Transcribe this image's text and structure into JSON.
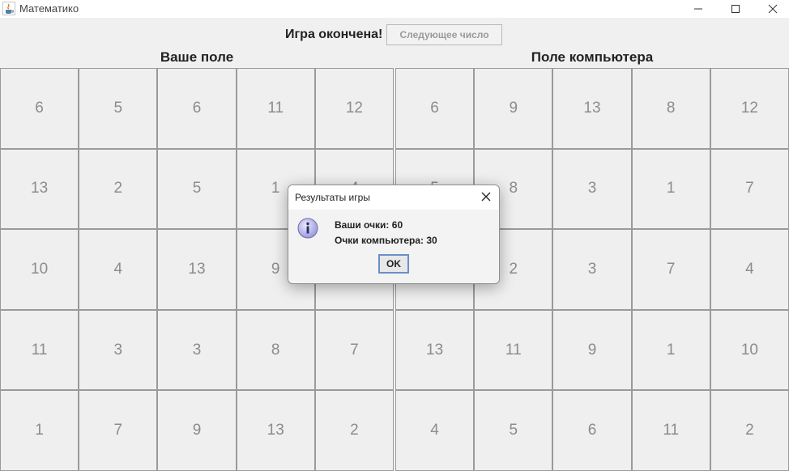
{
  "window": {
    "title": "Математико"
  },
  "status": {
    "game_over_text": "Игра окончена!",
    "next_number_label": "Следующее число"
  },
  "player_board": {
    "title": "Ваше поле",
    "cells": [
      "6",
      "5",
      "6",
      "11",
      "12",
      "13",
      "2",
      "5",
      "1",
      "4",
      "10",
      "4",
      "13",
      "9",
      "",
      "11",
      "3",
      "3",
      "8",
      "7",
      "1",
      "7",
      "9",
      "13",
      "2"
    ]
  },
  "computer_board": {
    "title": "Поле компьютера",
    "cells": [
      "6",
      "9",
      "13",
      "8",
      "12",
      "5",
      "8",
      "3",
      "1",
      "7",
      "",
      "2",
      "3",
      "7",
      "4",
      "13",
      "11",
      "9",
      "1",
      "10",
      "4",
      "5",
      "6",
      "11",
      "2"
    ]
  },
  "dialog": {
    "title": "Результаты игры",
    "player_score_text": "Ваши очки: 60",
    "computer_score_text": "Очки компьютера: 30",
    "ok_label": "OK"
  },
  "icons": {
    "app": "java-cup-icon",
    "info": "info-icon"
  },
  "colors": {
    "info_icon": "#9b9bdc",
    "dialog_button_border": "#6a8fc7"
  }
}
